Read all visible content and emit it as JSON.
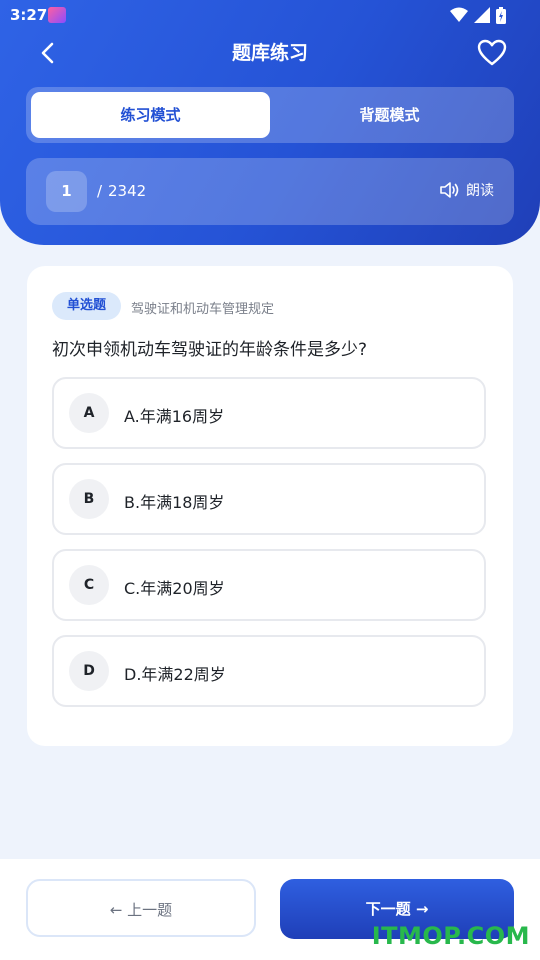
{
  "status_bar": {
    "time": "3:27"
  },
  "header": {
    "title": "题库练习"
  },
  "mode_tabs": [
    {
      "label": "练习模式",
      "active": true
    },
    {
      "label": "背题模式",
      "active": false
    }
  ],
  "progress": {
    "current": "1",
    "separator": "/",
    "total": "2342",
    "read_label": "朗读"
  },
  "question": {
    "type": "单选题",
    "category": "驾驶证和机动车管理规定",
    "text": "初次申领机动车驾驶证的年龄条件是多少?",
    "options": [
      {
        "letter": "A",
        "text": "A.年满16周岁"
      },
      {
        "letter": "B",
        "text": "B.年满18周岁"
      },
      {
        "letter": "C",
        "text": "C.年满20周岁"
      },
      {
        "letter": "D",
        "text": "D.年满22周岁"
      }
    ]
  },
  "footer": {
    "prev_label": "← 上一题",
    "next_label": "下一题 →"
  },
  "watermark": "ITMOP.COM",
  "colors": {
    "primary": "#2553d6",
    "primary_dark": "#1f3fb8",
    "page_bg": "#eef3fc",
    "watermark": "#28b84c"
  }
}
